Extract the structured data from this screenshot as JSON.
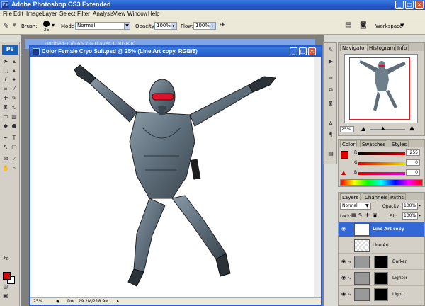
{
  "app": {
    "title": "Adobe Photoshop CS3 Extended",
    "ps_logo": "Ps"
  },
  "menu": [
    "File",
    "Edit",
    "Image",
    "Layer",
    "Select",
    "Filter",
    "Analysis",
    "View",
    "Window",
    "Help"
  ],
  "options": {
    "brush_label": "Brush:",
    "brush_size": "25",
    "mode_label": "Mode:",
    "mode_value": "Normal",
    "opacity_label": "Opacity:",
    "opacity_value": "100%",
    "flow_label": "Flow:",
    "flow_value": "100%",
    "workspace_label": "Workspace"
  },
  "background_document": {
    "title": "Untitled-1 @ 66.7% (Layer 1, RGB/8)"
  },
  "document": {
    "title": "Color Female Cryo Suit.psd @ 25% (Line Art copy, RGB/8)",
    "zoom": "25%",
    "doc_size": "Doc: 29.2M/218.9M"
  },
  "navigator": {
    "tabs": [
      "Navigator",
      "Histogram",
      "Info"
    ],
    "zoom": "25%"
  },
  "color": {
    "tabs": [
      "Color",
      "Swatches",
      "Styles"
    ],
    "channels": [
      {
        "label": "R",
        "value": "255"
      },
      {
        "label": "G",
        "value": "0"
      },
      {
        "label": "B",
        "value": "0"
      }
    ],
    "foreground": "#e00000"
  },
  "layers": {
    "tabs": [
      "Layers",
      "Channels",
      "Paths"
    ],
    "blend_mode": "Normal",
    "opacity_label": "Opacity:",
    "opacity_value": "100%",
    "lock_label": "Lock:",
    "fill_label": "Fill:",
    "fill_value": "100%",
    "items": [
      {
        "name": "Line Art copy",
        "selected": true
      },
      {
        "name": "Line Art",
        "selected": false
      },
      {
        "name": "Darker",
        "selected": false
      },
      {
        "name": "Lighter",
        "selected": false
      },
      {
        "name": "Light",
        "selected": false
      }
    ]
  },
  "colors": {
    "accent": "#3168d5",
    "suit_red": "#e0102a",
    "suit_gray": "#6e7f8c"
  }
}
